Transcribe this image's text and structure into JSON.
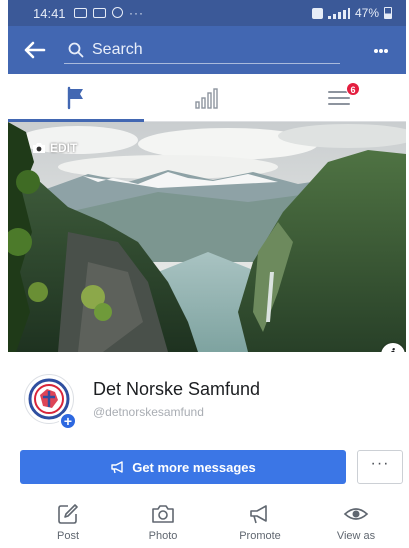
{
  "status_bar": {
    "time": "14:41",
    "left_dots": "···",
    "battery": "47%"
  },
  "nav": {
    "search_placeholder": "Search",
    "back_icon": "arrow-left-icon",
    "more_icon": "more-dots-icon"
  },
  "tabs": [
    {
      "name": "flag-icon",
      "active": true
    },
    {
      "name": "insights-bars-icon",
      "active": false
    },
    {
      "name": "menu-list-icon",
      "active": false,
      "badge": "6"
    }
  ],
  "cover": {
    "edit_label": "EDIT",
    "info_label": "i"
  },
  "profile": {
    "name": "Det Norske Samfund",
    "handle": "@detnorskesamfund"
  },
  "cta": {
    "label": "Get more messages",
    "more_label": "···"
  },
  "actions": [
    {
      "label": "Post",
      "icon": "pencil-square-icon"
    },
    {
      "label": "Photo",
      "icon": "camera-icon"
    },
    {
      "label": "Promote",
      "icon": "megaphone-icon"
    },
    {
      "label": "View as",
      "icon": "eye-icon"
    }
  ],
  "colors": {
    "status_bar": "#3b5998",
    "nav_bar": "#4267b2",
    "active_tab": "#4267b2",
    "badge": "#e41e3f",
    "cta": "#3b76e6"
  }
}
